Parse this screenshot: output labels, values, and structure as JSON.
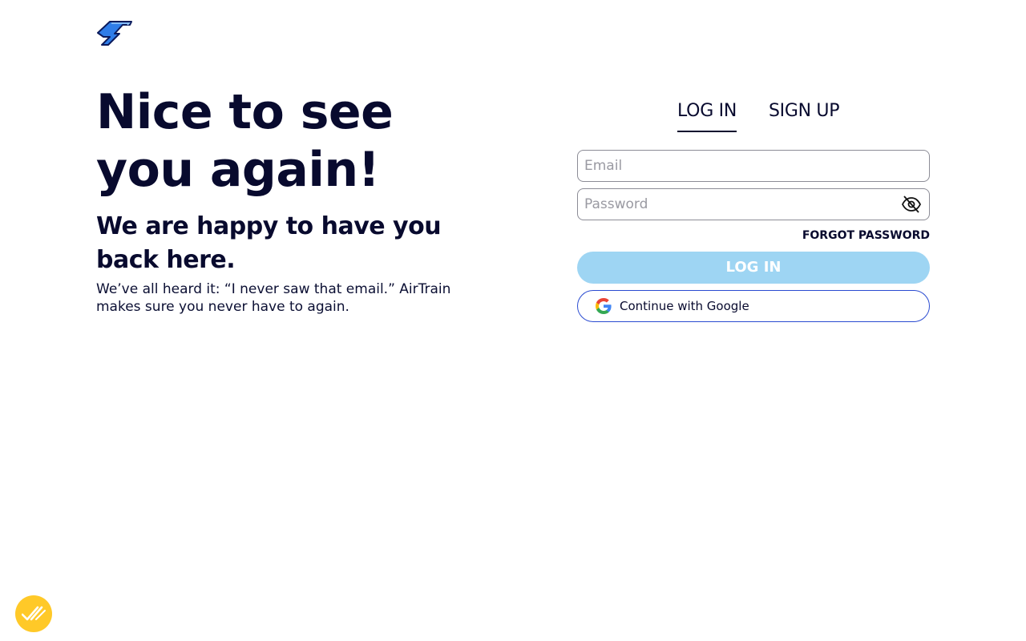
{
  "brand": {
    "logo_icon": "airtrain-bolt-logo",
    "colors": {
      "primary": "#080a2e",
      "accent_blue": "#1a5fd6",
      "button_disabled": "#9ed5f3",
      "fab": "#ffc928"
    }
  },
  "hero": {
    "title": "Nice to see you again!",
    "subtitle": "We are happy to have you back here.",
    "body": "We’ve all heard it: “I never saw that email.” AirTrain makes sure you never have to again."
  },
  "tabs": [
    {
      "label": "LOG IN",
      "active": true
    },
    {
      "label": "SIGN UP",
      "active": false
    }
  ],
  "form": {
    "email_placeholder": "Email",
    "password_placeholder": "Password",
    "password_toggle_icon": "eye-off-icon",
    "forgot_label": "FORGOT PASSWORD",
    "login_label": "LOG IN",
    "google_label": "Continue with Google",
    "google_icon": "google-icon"
  },
  "fab": {
    "icon": "double-check-icon"
  }
}
